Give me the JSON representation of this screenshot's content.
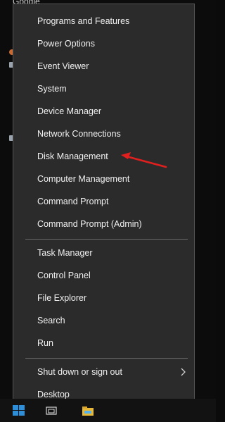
{
  "background": {
    "partial_label": "Google"
  },
  "menu": {
    "group1": [
      {
        "label": "Programs and Features"
      },
      {
        "label": "Power Options"
      },
      {
        "label": "Event Viewer"
      },
      {
        "label": "System"
      },
      {
        "label": "Device Manager"
      },
      {
        "label": "Network Connections"
      },
      {
        "label": "Disk Management"
      },
      {
        "label": "Computer Management"
      },
      {
        "label": "Command Prompt"
      },
      {
        "label": "Command Prompt (Admin)"
      }
    ],
    "group2": [
      {
        "label": "Task Manager"
      },
      {
        "label": "Control Panel"
      },
      {
        "label": "File Explorer"
      },
      {
        "label": "Search"
      },
      {
        "label": "Run"
      }
    ],
    "group3": [
      {
        "label": "Shut down or sign out"
      },
      {
        "label": "Desktop"
      }
    ]
  },
  "annotation": {
    "color": "#e0201e",
    "icon": "red-arrow-pointer"
  },
  "colors": {
    "menu_bg": "#2b2b2b",
    "text": "#f1f1f1",
    "divider": "#6a6a6a"
  }
}
